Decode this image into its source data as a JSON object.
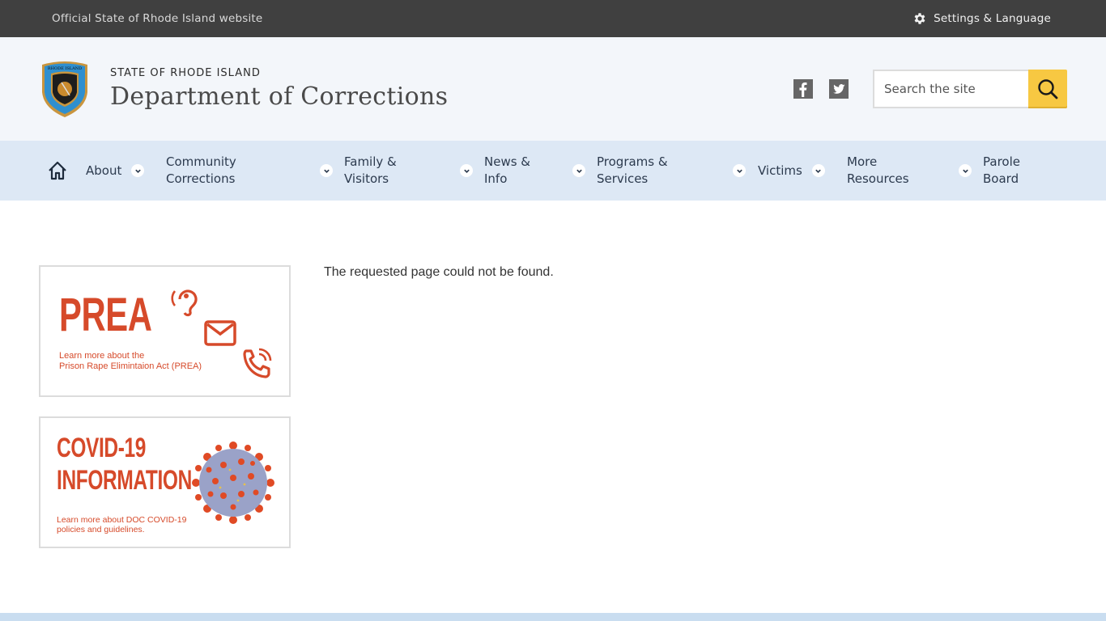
{
  "topbar": {
    "official_text": "Official State of Rhode Island website",
    "settings_label": "Settings & Language",
    "settings_icon": "gear-icon"
  },
  "header": {
    "state_label": "STATE OF RHODE ISLAND",
    "department": "Department of Corrections",
    "logo": "rhode-island-doc-seal",
    "social": [
      {
        "name": "facebook",
        "icon": "facebook-icon"
      },
      {
        "name": "twitter",
        "icon": "twitter-icon"
      }
    ],
    "search": {
      "placeholder": "Search the site",
      "value": "",
      "button_icon": "search-icon"
    }
  },
  "nav": {
    "home_icon": "home-icon",
    "items": [
      {
        "label": "About",
        "has_dropdown": true
      },
      {
        "label": "Community\nCorrections",
        "has_dropdown": true
      },
      {
        "label": "Family &\nVisitors",
        "has_dropdown": true
      },
      {
        "label": "News &\nInfo",
        "has_dropdown": true
      },
      {
        "label": "Programs &\nServices",
        "has_dropdown": true
      },
      {
        "label": "Victims",
        "has_dropdown": true
      },
      {
        "label": "More\nResources",
        "has_dropdown": true
      },
      {
        "label": "Parole\nBoard",
        "has_dropdown": false
      }
    ]
  },
  "sidebar": {
    "promos": [
      {
        "title": "PREA",
        "subtitle": "Learn more about the\nPrison Rape Elimintaion Act (PREA)",
        "icons": [
          "ear-icon",
          "envelope-icon",
          "phone-icon"
        ]
      },
      {
        "title_line1": "COVID-19",
        "title_line2": "INFORMATION",
        "subtitle": "Learn more about DOC COVID-19\npolicies and guidelines.",
        "icons": [
          "virus-icon"
        ]
      }
    ]
  },
  "content": {
    "message": "The requested page could not be found."
  },
  "colors": {
    "topbar_bg": "#404040",
    "header_bg": "#f3f6fa",
    "nav_bg": "#dde8f5",
    "search_button": "#f7c842",
    "promo_accent": "#d64a2a",
    "footer_strip": "#c9ddf0"
  }
}
